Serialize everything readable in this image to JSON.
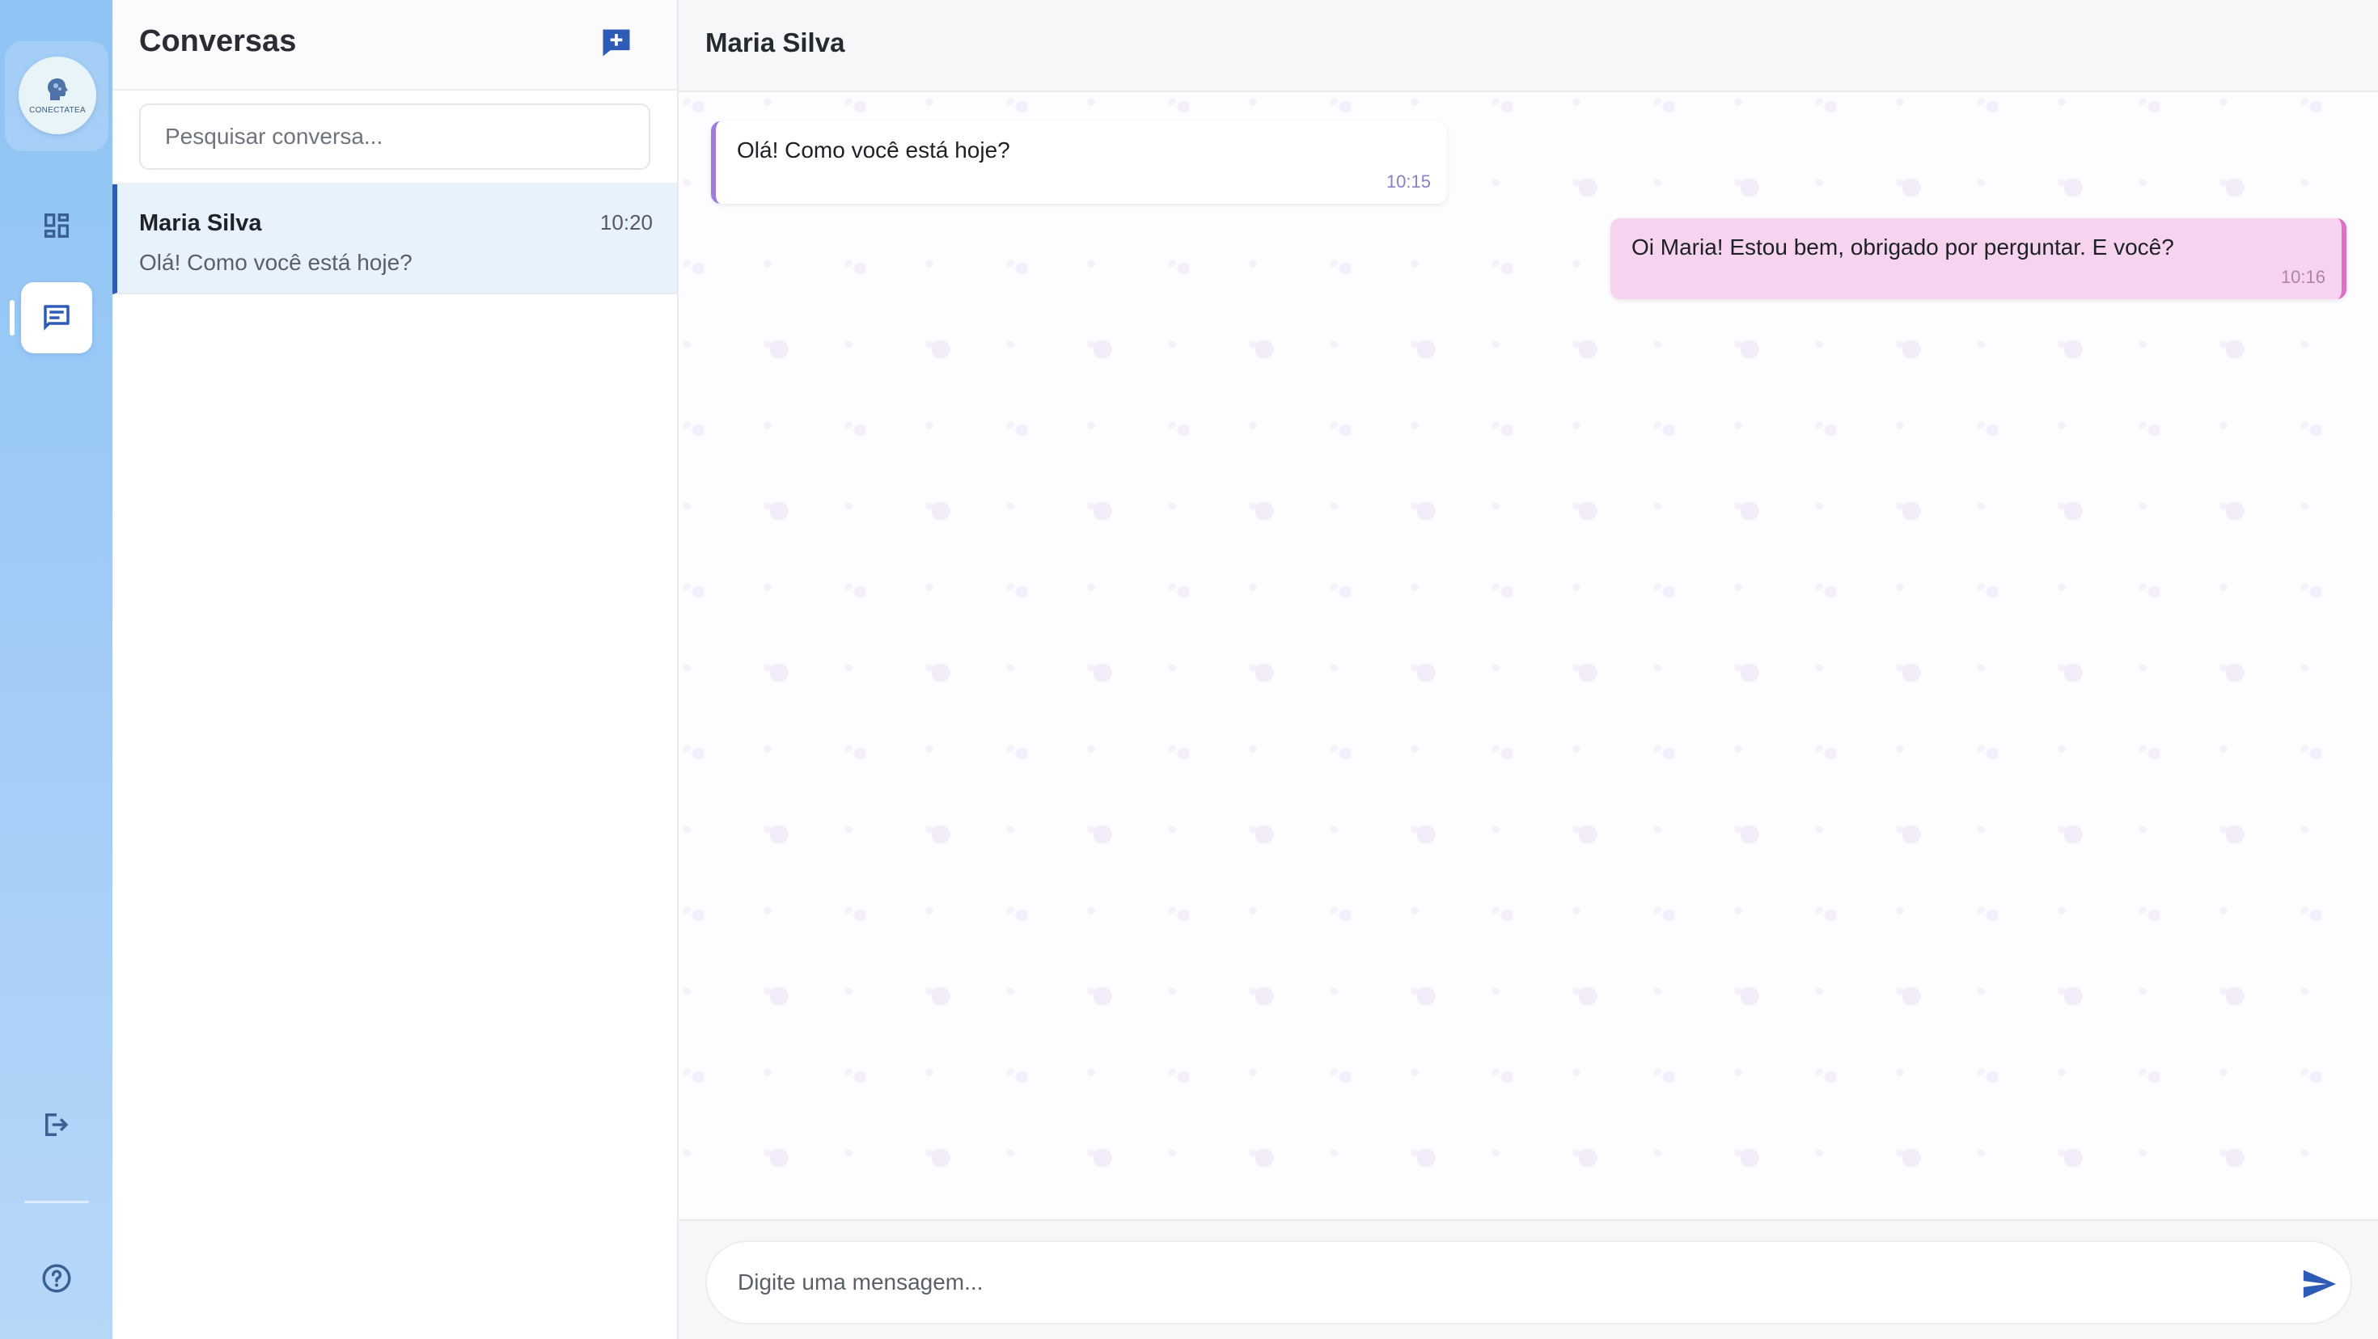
{
  "app": {
    "logo_text": "CONECTATEA",
    "colors": {
      "accent": "#2e5bb6",
      "rail": "#a4cdf6",
      "incoming_border": "#9e7be0",
      "outgoing_bg": "#f6d3ef",
      "outgoing_border": "#e06fc7"
    }
  },
  "rail": {
    "items": [
      {
        "icon": "dashboard-icon"
      },
      {
        "icon": "chat-icon",
        "active": true
      },
      {
        "icon": "logout-icon"
      },
      {
        "icon": "help-icon"
      }
    ]
  },
  "list": {
    "title": "Conversas",
    "new_chat_icon": "new-chat-icon",
    "search_placeholder": "Pesquisar conversa...",
    "conversations": [
      {
        "name": "Maria Silva",
        "time": "10:20",
        "preview": "Olá! Como você está hoje?"
      }
    ]
  },
  "chat": {
    "title": "Maria Silva",
    "messages": [
      {
        "direction": "incoming",
        "text": "Olá! Como você está hoje?",
        "time": "10:15"
      },
      {
        "direction": "outgoing",
        "text": "Oi Maria! Estou bem, obrigado por perguntar. E você?",
        "time": "10:16"
      }
    ],
    "input_placeholder": "Digite uma mensagem...",
    "send_icon": "send-icon"
  }
}
